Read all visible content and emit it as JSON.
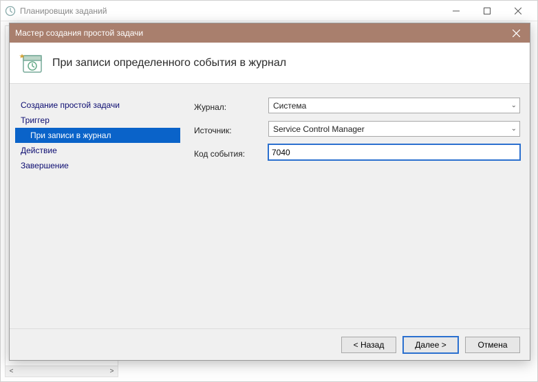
{
  "outer": {
    "title": "Планировщик заданий"
  },
  "wizard": {
    "title": "Мастер создания простой задачи",
    "header": "При записи определенного события в журнал",
    "steps": {
      "create": "Создание простой задачи",
      "trigger": "Триггер",
      "onlog": "При записи в журнал",
      "action": "Действие",
      "finish": "Завершение"
    },
    "form": {
      "log_label": "Журнал:",
      "log_value": "Система",
      "source_label": "Источник:",
      "source_value": "Service Control Manager",
      "eventid_label": "Код события:",
      "eventid_value": "7040"
    },
    "buttons": {
      "back": "< Назад",
      "next": "Далее >",
      "cancel": "Отмена"
    }
  }
}
